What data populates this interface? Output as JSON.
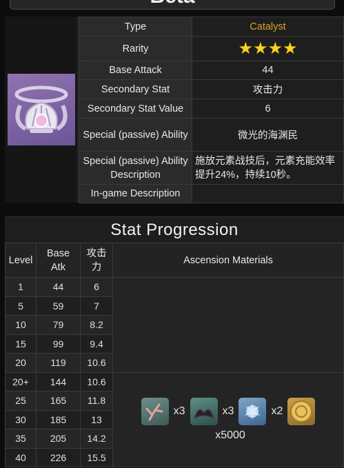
{
  "header": {
    "title": "Beta"
  },
  "weapon": {
    "rows": {
      "type": {
        "label": "Type",
        "value": "Catalyst"
      },
      "rarity": {
        "label": "Rarity",
        "value": "★★★★",
        "stars": 4
      },
      "base_attack": {
        "label": "Base Attack",
        "value": "44"
      },
      "secondary_stat": {
        "label": "Secondary Stat",
        "value": "攻击力"
      },
      "secondary_stat_value": {
        "label": "Secondary Stat Value",
        "value": "6"
      },
      "special": {
        "label": "Special (passive) Ability",
        "value": "微光的海渊民"
      },
      "special_desc": {
        "label": "Special (passive) Ability Description",
        "value": "施放元素战技后，元素充能效率提升24%，持续10秒。"
      },
      "ingame": {
        "label": "In-game Description",
        "value": ""
      }
    }
  },
  "progression": {
    "title": "Stat Progression",
    "headers": {
      "level": "Level",
      "base_atk": "Base Atk",
      "stat": "攻击力",
      "materials": "Ascension Materials"
    },
    "rows": [
      {
        "level": "1",
        "atk": "44",
        "stat": "6"
      },
      {
        "level": "5",
        "atk": "59",
        "stat": "7"
      },
      {
        "level": "10",
        "atk": "79",
        "stat": "8.2"
      },
      {
        "level": "15",
        "atk": "99",
        "stat": "9.4"
      },
      {
        "level": "20",
        "atk": "119",
        "stat": "10.6"
      },
      {
        "level": "20+",
        "atk": "144",
        "stat": "10.6"
      },
      {
        "level": "25",
        "atk": "165",
        "stat": "11.8"
      },
      {
        "level": "30",
        "atk": "185",
        "stat": "13"
      },
      {
        "level": "35",
        "atk": "205",
        "stat": "14.2"
      },
      {
        "level": "40",
        "atk": "226",
        "stat": "15.5"
      }
    ],
    "ascension": {
      "materials": [
        {
          "icon": "coral-branch-icon",
          "qty": "x3"
        },
        {
          "icon": "horn-icon",
          "qty": "x3"
        },
        {
          "icon": "spirit-essence-icon",
          "qty": "x2"
        },
        {
          "icon": "mora-coin-icon",
          "qty": ""
        }
      ],
      "mora": "x5000"
    }
  },
  "colors": {
    "accent_gold": "#d9a527",
    "star": "#ffd21a",
    "weapon_bg": "#8f73b0"
  }
}
